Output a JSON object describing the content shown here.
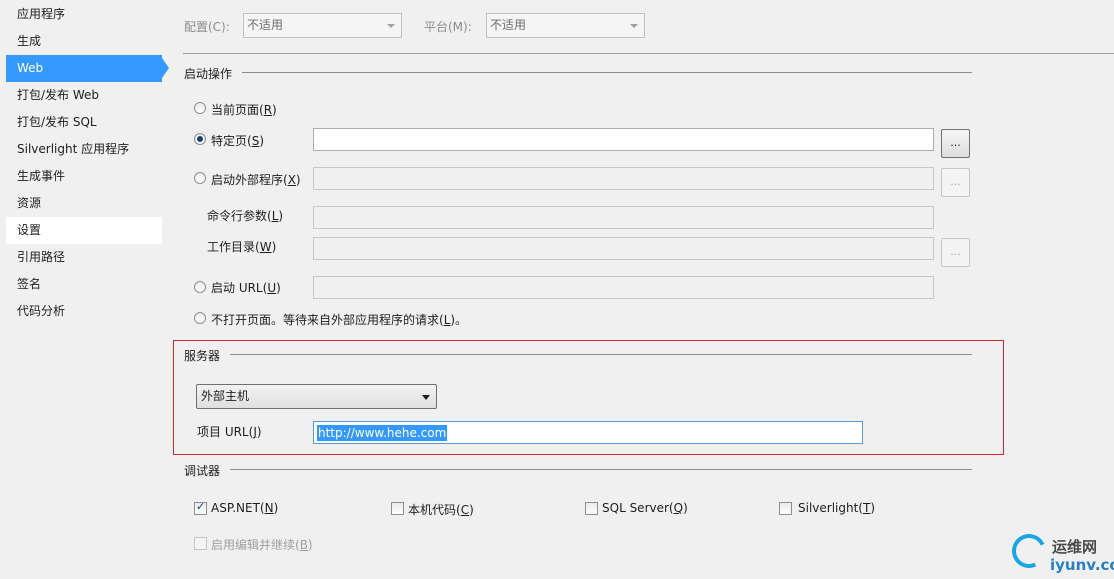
{
  "sidebar": {
    "items": [
      {
        "label": "应用程序"
      },
      {
        "label": "生成"
      },
      {
        "label": "Web"
      },
      {
        "label": "打包/发布 Web"
      },
      {
        "label": "打包/发布 SQL"
      },
      {
        "label": "Silverlight 应用程序"
      },
      {
        "label": "生成事件"
      },
      {
        "label": "资源"
      },
      {
        "label": "设置"
      },
      {
        "label": "引用路径"
      },
      {
        "label": "签名"
      },
      {
        "label": "代码分析"
      }
    ],
    "selected": "Web"
  },
  "config": {
    "config_label": "配置(C):",
    "config_value": "不适用",
    "platform_label": "平台(M):",
    "platform_value": "不适用"
  },
  "start_action": {
    "title": "启动操作",
    "current_page": {
      "text": "当前页面(",
      "key": "R",
      "end": ")"
    },
    "specific_page": {
      "text": "特定页(",
      "key": "S",
      "end": ")",
      "value": "",
      "browse": "..."
    },
    "external_program": {
      "text": "启动外部程序(",
      "key": "X",
      "end": ")",
      "browse": "..."
    },
    "cmd_args": {
      "text": "命令行参数(",
      "key": "L",
      "end": ")"
    },
    "work_dir": {
      "text": "工作目录(",
      "key": "W",
      "end": ")",
      "browse": "..."
    },
    "start_url": {
      "text": "启动 URL(",
      "key": "U",
      "end": ")"
    },
    "no_open": {
      "text": "不打开页面。等待来自外部应用程序的请求(",
      "key": "L",
      "end": ")。"
    }
  },
  "server": {
    "title": "服务器",
    "host_selected": "外部主机",
    "project_url_label": {
      "text": "项目 URL(",
      "key": "J",
      "end": ")"
    },
    "project_url_value": "http://www.hehe.com"
  },
  "debuggers": {
    "title": "调试器",
    "aspnet": {
      "text": "ASP.NET(",
      "key": "N",
      "end": ")",
      "checked": true
    },
    "native": {
      "text": "本机代码(",
      "key": "C",
      "end": ")",
      "checked": false
    },
    "sql": {
      "text": "SQL Server(",
      "key": "Q",
      "end": ")",
      "checked": false
    },
    "silverlight": {
      "text": "Silverlight(",
      "key": "T",
      "end": ")",
      "checked": false
    },
    "edit_continue": {
      "text": "启用编辑并继续(",
      "key": "B",
      "end": ")",
      "checked": false
    }
  },
  "watermark": {
    "line1": "运维网",
    "line2": "iyunv.com"
  },
  "colors": {
    "selection": "#3399ff",
    "highlight_border": "#d9282b"
  }
}
